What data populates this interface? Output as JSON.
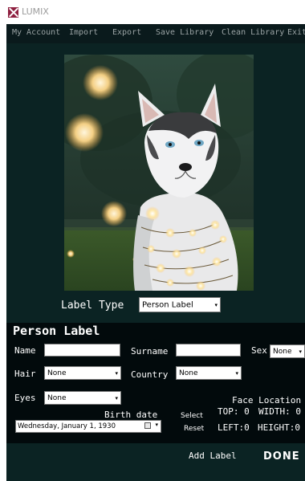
{
  "app": {
    "title": "LUMIX"
  },
  "menu": {
    "items": [
      "My Account",
      "Import",
      "Export",
      "Save Library",
      "Clean Library",
      "Exit"
    ]
  },
  "label_type": {
    "label": "Label Type",
    "value": "Person Label"
  },
  "person_label": {
    "title": "Person Label",
    "name_label": "Name",
    "name_value": "",
    "surname_label": "Surname",
    "surname_value": "",
    "sex_label": "Sex",
    "sex_value": "None",
    "hair_label": "Hair",
    "hair_value": "None",
    "country_label": "Country",
    "country_value": "None",
    "eyes_label": "Eyes",
    "eyes_value": "None",
    "birth_date_label": "Birth date",
    "birth_date_value": "Wednesday,  January   1, 1930",
    "select_label": "Select",
    "reset_label": "Reset",
    "face_location": {
      "title": "Face Location",
      "top_label": "TOP: 0",
      "width_label": "WIDTH: 0",
      "left_label": "LEFT:0",
      "height_label": "HEIGHT:0"
    }
  },
  "footer": {
    "add_label": "Add Label",
    "done_label": "DONE"
  },
  "colors": {
    "background": "#0b2323",
    "menubar": "#0a1a1c",
    "panel": "#020a0c",
    "logo": "#8e1f3f"
  }
}
